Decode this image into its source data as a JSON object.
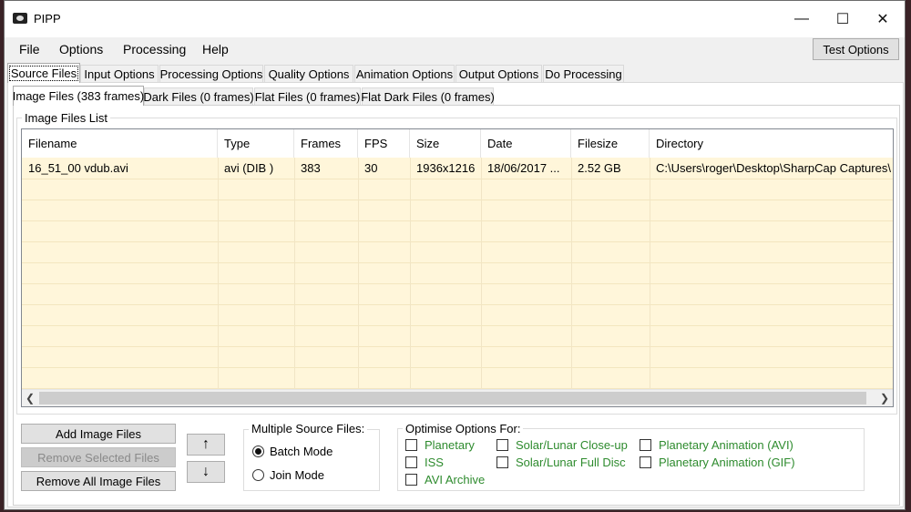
{
  "window": {
    "title": "PIPP",
    "minimize_glyph": "—",
    "maximize_glyph": "☐",
    "close_glyph": "✕"
  },
  "menu": {
    "items": [
      "File",
      "Options",
      "Processing",
      "Help"
    ],
    "test_options": "Test Options"
  },
  "main_tabs": [
    "Source Files",
    "Input Options",
    "Processing Options",
    "Quality Options",
    "Animation Options",
    "Output Options",
    "Do Processing"
  ],
  "sub_tabs": [
    "Image Files (383 frames)",
    "Dark Files (0 frames)",
    "Flat Files (0 frames)",
    "Flat Dark Files (0 frames)"
  ],
  "file_list": {
    "group_label": "Image Files List",
    "columns": [
      "Filename",
      "Type",
      "Frames",
      "FPS",
      "Size",
      "Date",
      "Filesize",
      "Directory"
    ],
    "rows": [
      [
        "16_51_00 vdub.avi",
        "avi (DIB )",
        "383",
        "30",
        "1936x1216",
        "18/06/2017 ...",
        "2.52 GB",
        "C:\\Users\\roger\\Desktop\\SharpCap Captures\\..."
      ]
    ]
  },
  "buttons": {
    "add": "Add Image Files",
    "remove_selected": "Remove Selected Files",
    "remove_all": "Remove All Image Files",
    "up": "↑",
    "down": "↓"
  },
  "multiple_source": {
    "label": "Multiple Source Files:",
    "options": [
      "Batch Mode",
      "Join Mode"
    ],
    "selected": "Batch Mode"
  },
  "optimise": {
    "label": "Optimise Options For:",
    "options": [
      "Planetary",
      "ISS",
      "AVI Archive",
      "Solar/Lunar Close-up",
      "Solar/Lunar Full Disc",
      "Planetary Animation (AVI)",
      "Planetary Animation (GIF)"
    ]
  },
  "colors": {
    "list_background": "#fff6da",
    "option_text": "#2e8b2e"
  }
}
